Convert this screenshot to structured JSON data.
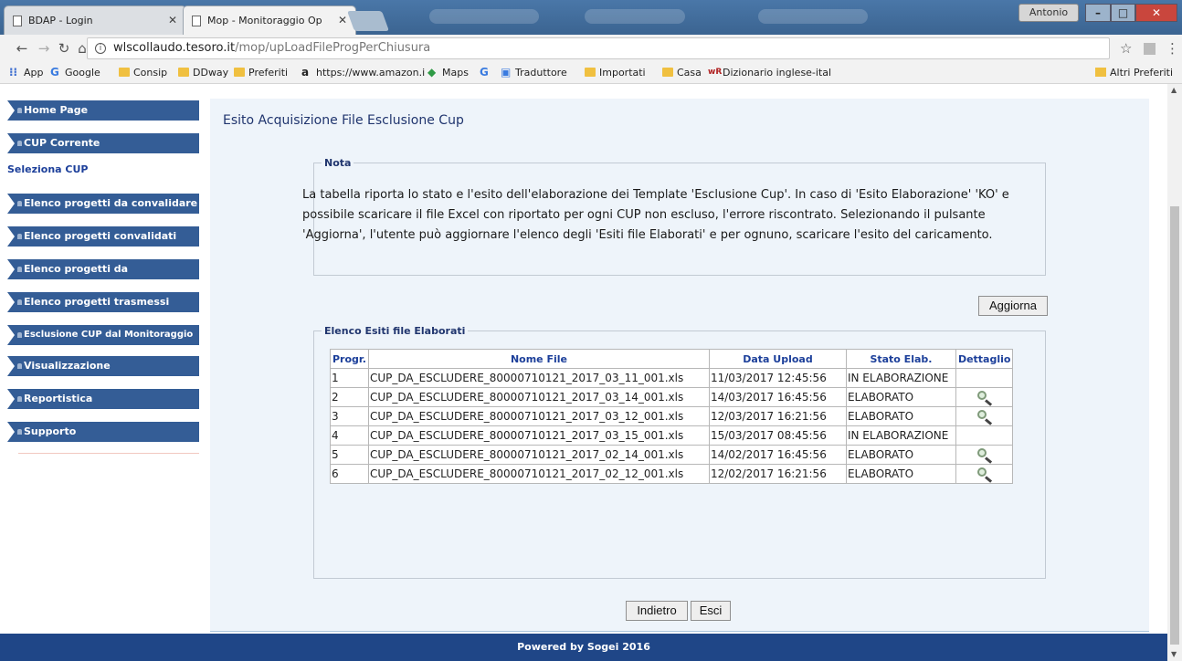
{
  "browser": {
    "tabs": [
      {
        "title": "BDAP - Login",
        "active": false
      },
      {
        "title": "Mop - Monitoraggio Op",
        "active": true
      }
    ],
    "user": "Antonio",
    "url": {
      "host": "wlscollaudo.tesoro.it",
      "path": "/mop/upLoadFileProgPerChiusura"
    },
    "bookmarks": [
      {
        "label": "App",
        "icon": "apps-grid-icon"
      },
      {
        "label": "Google",
        "icon": "google-icon"
      },
      {
        "label": "Consip",
        "icon": "folder-icon"
      },
      {
        "label": "DDway",
        "icon": "folder-icon"
      },
      {
        "label": "Preferiti",
        "icon": "folder-icon"
      },
      {
        "label": "https://www.amazon.i",
        "icon": "amazon-icon"
      },
      {
        "label": "Maps",
        "icon": "maps-icon"
      },
      {
        "label": "",
        "icon": "google-icon"
      },
      {
        "label": "Traduttore",
        "icon": "translate-icon"
      },
      {
        "label": "Importati",
        "icon": "folder-icon"
      },
      {
        "label": "Casa",
        "icon": "folder-icon"
      },
      {
        "label": "Dizionario inglese-ital",
        "icon": "wordreference-icon"
      }
    ],
    "other_bookmarks": "Altri Preferiti"
  },
  "sidebar": {
    "items": [
      {
        "label": "Home Page"
      },
      {
        "label": "CUP Corrente"
      },
      {
        "label": "Elenco progetti da convalidare"
      },
      {
        "label": "Elenco progetti convalidati"
      },
      {
        "label": "Elenco progetti da trasmettere"
      },
      {
        "label": "Elenco progetti trasmessi"
      },
      {
        "label": "Esclusione CUP dal Monitoraggio"
      },
      {
        "label": "Visualizzazione"
      },
      {
        "label": "Reportistica"
      },
      {
        "label": "Supporto"
      }
    ],
    "sub_link": "Seleziona CUP"
  },
  "main": {
    "title": "Esito Acquisizione File Esclusione Cup",
    "nota": {
      "legend": "Nota",
      "text": "La tabella riporta lo stato e l'esito dell'elaborazione dei Template 'Esclusione Cup'. In caso di 'Esito Elaborazione' 'KO' e possibile scaricare il file Excel con riportato per ogni CUP non escluso, l'errore riscontrato. Selezionando il pulsante 'Aggiorna', l'utente può aggiornare l'elenco degli 'Esiti file Elaborati' e per ognuno, scaricare l'esito del caricamento."
    },
    "refresh_label": "Aggiorna",
    "esiti": {
      "legend": "Elenco Esiti file Elaborati",
      "columns": [
        "Progr.",
        "Nome File",
        "Data Upload",
        "Stato Elab.",
        "Dettaglio"
      ],
      "rows": [
        {
          "progr": "1",
          "file": "CUP_DA_ESCLUDERE_80000710121_2017_03_11_001.xls",
          "date": "11/03/2017 12:45:56",
          "state": "IN ELABORAZIONE",
          "detail": false
        },
        {
          "progr": "2",
          "file": "CUP_DA_ESCLUDERE_80000710121_2017_03_14_001.xls",
          "date": "14/03/2017 16:45:56",
          "state": "ELABORATO",
          "detail": true
        },
        {
          "progr": "3",
          "file": "CUP_DA_ESCLUDERE_80000710121_2017_03_12_001.xls",
          "date": "12/03/2017 16:21:56",
          "state": "ELABORATO",
          "detail": true
        },
        {
          "progr": "4",
          "file": "CUP_DA_ESCLUDERE_80000710121_2017_03_15_001.xls",
          "date": "15/03/2017 08:45:56",
          "state": "IN ELABORAZIONE",
          "detail": false
        },
        {
          "progr": "5",
          "file": "CUP_DA_ESCLUDERE_80000710121_2017_02_14_001.xls",
          "date": "14/02/2017 16:45:56",
          "state": "ELABORATO",
          "detail": true
        },
        {
          "progr": "6",
          "file": "CUP_DA_ESCLUDERE_80000710121_2017_02_12_001.xls",
          "date": "12/02/2017 16:21:56",
          "state": "ELABORATO",
          "detail": true
        }
      ]
    },
    "back_label": "Indietro",
    "exit_label": "Esci"
  },
  "footer": {
    "text": "Powered by Sogei 2016"
  },
  "colors": {
    "sidebar": "#345d96",
    "footer": "#1f4687",
    "content_bg": "#eef4fa",
    "link": "#1c3f9a"
  }
}
